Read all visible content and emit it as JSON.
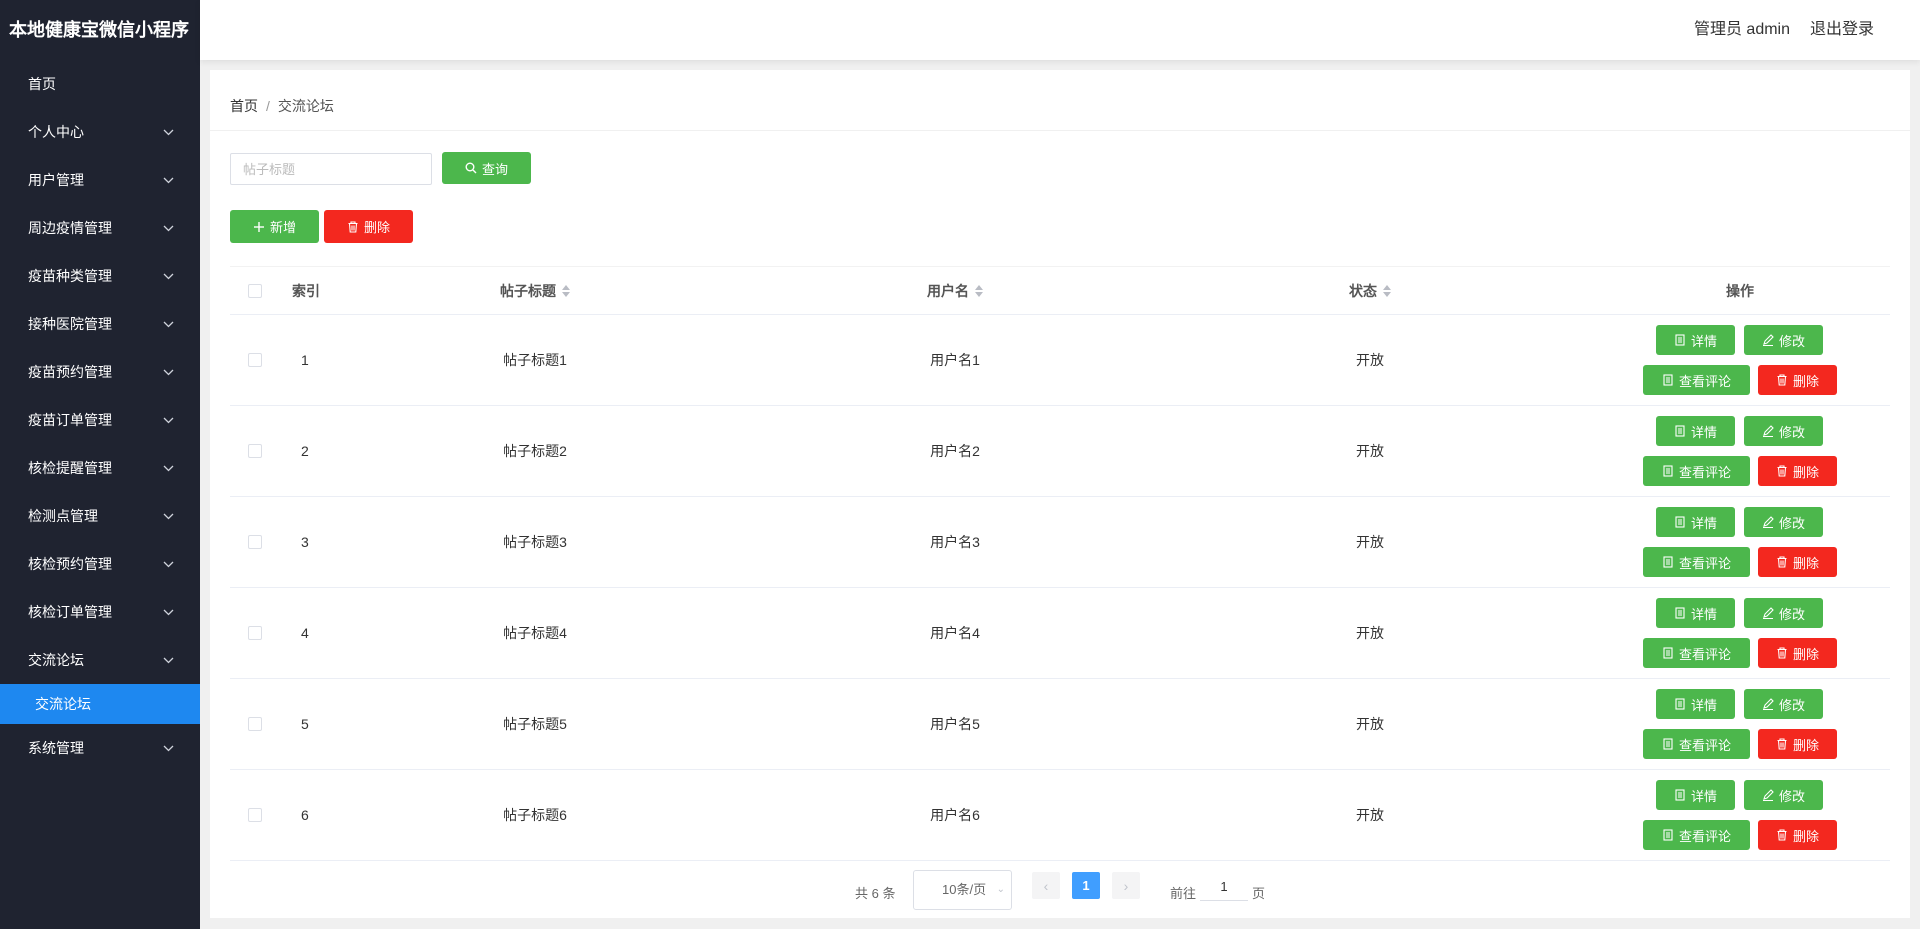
{
  "brand": "本地健康宝微信小程序",
  "header": {
    "admin_label": "管理员 admin",
    "logout_label": "退出登录"
  },
  "sidebar": {
    "items": [
      {
        "label": "首页",
        "expandable": false
      },
      {
        "label": "个人中心",
        "expandable": true
      },
      {
        "label": "用户管理",
        "expandable": true
      },
      {
        "label": "周边疫情管理",
        "expandable": true
      },
      {
        "label": "疫苗种类管理",
        "expandable": true
      },
      {
        "label": "接种医院管理",
        "expandable": true
      },
      {
        "label": "疫苗预约管理",
        "expandable": true
      },
      {
        "label": "疫苗订单管理",
        "expandable": true
      },
      {
        "label": "核检提醒管理",
        "expandable": true
      },
      {
        "label": "检测点管理",
        "expandable": true
      },
      {
        "label": "核检预约管理",
        "expandable": true
      },
      {
        "label": "核检订单管理",
        "expandable": true
      },
      {
        "label": "交流论坛",
        "expandable": true
      },
      {
        "label": "系统管理",
        "expandable": true
      }
    ],
    "active_sub": "交流论坛"
  },
  "breadcrumb": {
    "home": "首页",
    "sep": "/",
    "current": "交流论坛"
  },
  "search": {
    "placeholder": "帖子标题",
    "button": "查询"
  },
  "actions": {
    "add": "新增",
    "delete": "删除"
  },
  "table": {
    "headers": {
      "index": "索引",
      "title": "帖子标题",
      "user": "用户名",
      "status": "状态",
      "ops": "操作"
    },
    "rows": [
      {
        "index": "1",
        "title": "帖子标题1",
        "user": "用户名1",
        "status": "开放"
      },
      {
        "index": "2",
        "title": "帖子标题2",
        "user": "用户名2",
        "status": "开放"
      },
      {
        "index": "3",
        "title": "帖子标题3",
        "user": "用户名3",
        "status": "开放"
      },
      {
        "index": "4",
        "title": "帖子标题4",
        "user": "用户名4",
        "status": "开放"
      },
      {
        "index": "5",
        "title": "帖子标题5",
        "user": "用户名5",
        "status": "开放"
      },
      {
        "index": "6",
        "title": "帖子标题6",
        "user": "用户名6",
        "status": "开放"
      }
    ],
    "row_buttons": {
      "detail": "详情",
      "edit": "修改",
      "comments": "查看评论",
      "remove": "删除"
    }
  },
  "pagination": {
    "total": "共 6 条",
    "page_size": "10条/页",
    "current": "1",
    "goto": "前往",
    "goto_value": "1",
    "page_unit": "页"
  },
  "colors": {
    "sidebar_bg": "#1f2330",
    "active": "#1e88f0",
    "green": "#4cb74c",
    "red": "#f3281f",
    "pager_active": "#409eff"
  }
}
